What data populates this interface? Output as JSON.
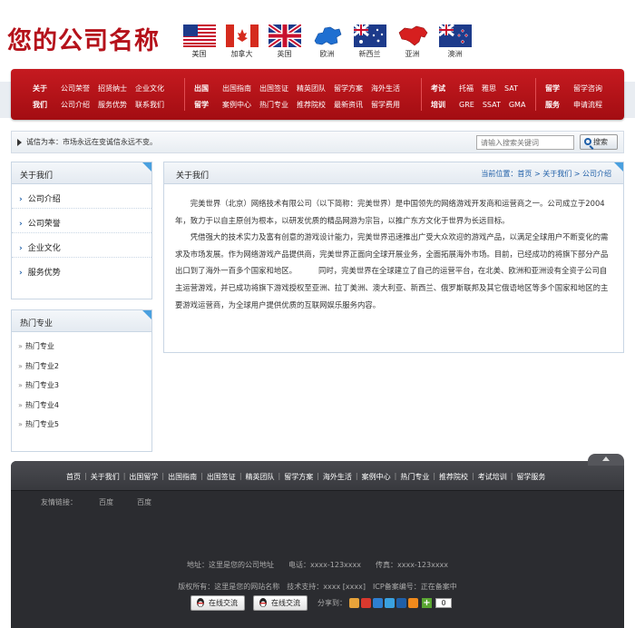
{
  "header": {
    "logo": "您的公司名称",
    "flags": [
      {
        "label": "美国",
        "icon": "usa-flag-icon"
      },
      {
        "label": "加拿大",
        "icon": "canada-flag-icon"
      },
      {
        "label": "英国",
        "icon": "uk-flag-icon"
      },
      {
        "label": "欧洲",
        "icon": "europe-map-icon"
      },
      {
        "label": "新西兰",
        "icon": "australia-flag-icon"
      },
      {
        "label": "亚洲",
        "icon": "asia-map-icon"
      },
      {
        "label": "澳洲",
        "icon": "newzealand-flag-icon"
      }
    ]
  },
  "nav": {
    "groups": [
      {
        "rows": [
          {
            "head": "关于",
            "items": [
              "公司荣誉",
              "招贤纳士",
              "企业文化"
            ]
          },
          {
            "head": "我们",
            "items": [
              "公司介绍",
              "服务优势",
              "联系我们"
            ]
          }
        ]
      },
      {
        "rows": [
          {
            "head": "出国",
            "items": [
              "出国指南",
              "出国签证",
              "精英团队",
              "留学方案",
              "海外生活"
            ]
          },
          {
            "head": "留学",
            "items": [
              "案例中心",
              "热门专业",
              "推荐院校",
              "最新资讯",
              "留学费用"
            ]
          }
        ]
      },
      {
        "rows": [
          {
            "head": "考试",
            "items": [
              "托福",
              "雅思",
              "SAT"
            ]
          },
          {
            "head": "培训",
            "items": [
              "GRE",
              "SSAT",
              "GMA"
            ]
          }
        ]
      },
      {
        "rows": [
          {
            "head": "留学",
            "items": [
              "留学咨询"
            ]
          },
          {
            "head": "服务",
            "items": [
              "申请流程"
            ]
          }
        ]
      }
    ]
  },
  "notice": {
    "text": "诚信为本：市场永远在变诚信永远不变。",
    "search_placeholder": "请输入搜索关键词",
    "search_button": "搜索"
  },
  "sidebar": {
    "about_title": "关于我们",
    "about_items": [
      "公司介绍",
      "公司荣誉",
      "企业文化",
      "服务优势"
    ],
    "hot_title": "热门专业",
    "hot_items": [
      "热门专业",
      "热门专业2",
      "热门专业3",
      "热门专业4",
      "热门专业5"
    ]
  },
  "main": {
    "title": "关于我们",
    "crumb_label": "当前位置：",
    "crumb_home": "首页",
    "crumb_parent": "关于我们",
    "crumb_current": "公司介绍",
    "crumb_sep": " > ",
    "p1": "完美世界（北京）网络技术有限公司（以下简称：完美世界）是中国领先的网络游戏开发商和运营商之一。公司成立于2004年，致力于以自主原创为根本，以研发优质的精品网游为宗旨，以推广东方文化于世界为长远目标。",
    "p2a": "凭借强大的技术实力及富有创意的游戏设计能力，完美世界迅速推出广受大众欢迎的游戏产品，以满足全球用户不断变化的需求及市场发展。作为网络游戏产品提供商，完美世界正面向全球开展业务，全面拓展海外市场。目前，已经成功的将旗下部分产品出口到了海外一百多个国家和地区。",
    "p2b": "同时，完美世界在全球建立了自己的运营平台，在北美、欧洲和亚洲设有全资子公司自主运营游戏，并已成功将旗下游戏授权至亚洲、拉丁美洲、澳大利亚、新西兰、俄罗斯联邦及其它俄语地区等多个国家和地区的主要游戏运营商，为全球用户提供优质的互联网娱乐服务内容。"
  },
  "footer": {
    "links": [
      "首页",
      "关于我们",
      "出国留学",
      "出国指南",
      "出国签证",
      "精英团队",
      "留学方案",
      "海外生活",
      "案例中心",
      "热门专业",
      "推荐院校",
      "考试培训",
      "留学服务"
    ],
    "friend_label": "友情链接：",
    "friend_links": [
      "百度",
      "百度"
    ],
    "address": "地址：这里是您的公司地址　　电话：xxxx-123xxxx　　传真：xxxx-123xxxx",
    "copyright": "版权所有：这里是您的网站名称　技术支持：xxxx [xxxx]　ICP备案编号：正在备案中",
    "chat_buttons": [
      "在线交流",
      "在线交流"
    ],
    "share_label": "分享到：",
    "share_count": "0",
    "share_colors": [
      "#e8a33a",
      "#d9392e",
      "#2e7fd1",
      "#3aa1e0",
      "#1f5fa8",
      "#f08a1c"
    ]
  }
}
